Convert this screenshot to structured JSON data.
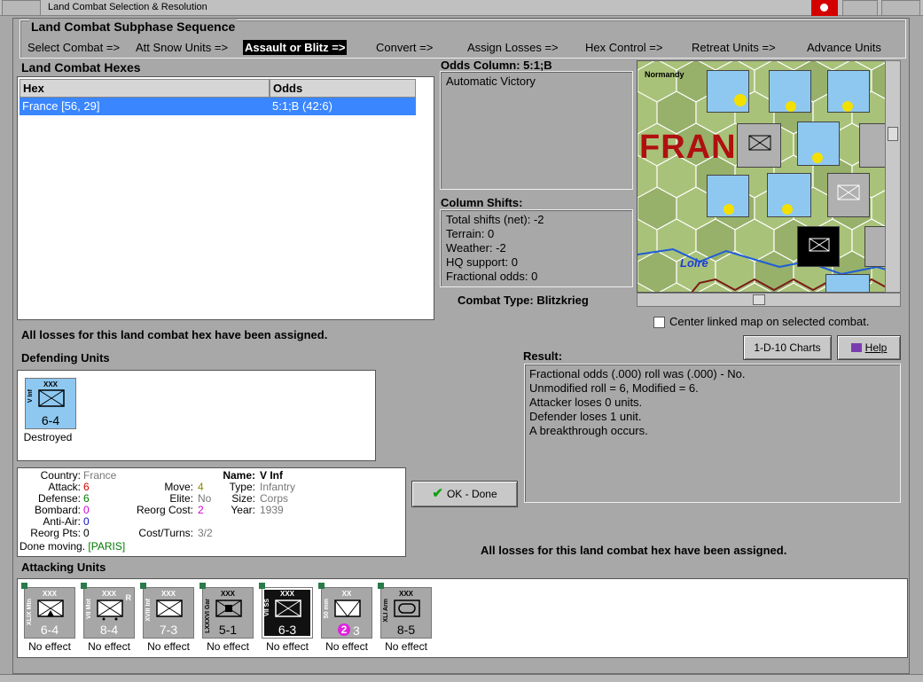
{
  "window_title": "Land Combat Selection & Resolution",
  "sequence": {
    "title": "Land Combat Subphase Sequence",
    "steps": [
      "Select Combat =>",
      "Att Snow Units =>",
      "Assault or Blitz =>",
      "Convert =>",
      "Assign Losses =>",
      "Hex Control =>",
      "Retreat Units =>",
      "Advance Units"
    ],
    "active_step": "Assault or Blitz =>"
  },
  "hexes_panel": {
    "title": "Land Combat Hexes",
    "columns": [
      "Hex",
      "Odds"
    ],
    "rows": [
      {
        "hex": "France [56, 29]",
        "odds": "5:1;B (42:6)"
      }
    ]
  },
  "odds_column": {
    "title": "Odds Column: 5:1;B",
    "result_text": "Automatic Victory"
  },
  "column_shifts": {
    "title": "Column Shifts:",
    "lines": [
      "Total shifts (net): -2",
      "Terrain: 0",
      "Weather: -2",
      "HQ support: 0",
      "Fractional odds: 0"
    ]
  },
  "combat_type": "Combat Type:  Blitzkrieg",
  "map": {
    "labels": {
      "normandy": "Normandy",
      "france": "FRANC",
      "loire": "Loire"
    },
    "center_label": "Center linked map on selected combat."
  },
  "status_message": "All losses for this land combat hex have been assigned.",
  "buttons": {
    "charts": "1-D-10 Charts",
    "help": "Help",
    "ok": "OK - Done"
  },
  "result": {
    "title": "Result:",
    "lines": [
      "Fractional odds (.000) roll was (.000)  - No.",
      "Unmodified roll = 6, Modified = 6.",
      "Attacker loses 0 units.",
      "Defender loses 1 unit.",
      "A breakthrough occurs."
    ]
  },
  "defending": {
    "title": "Defending Units",
    "units": [
      {
        "top": "XXX",
        "side": "V Inf",
        "value": "6-4",
        "status": "Destroyed"
      }
    ]
  },
  "details": {
    "country_label": "Country:",
    "country": "France",
    "attack_label": "Attack:",
    "attack": "6",
    "defense_label": "Defense:",
    "defense": "6",
    "bombard_label": "Bombard:",
    "bombard": "0",
    "antiair_label": "Anti-Air:",
    "antiair": "0",
    "reorgpts_label": "Reorg Pts:",
    "reorgpts": "0",
    "move_label": "Move:",
    "move": "4",
    "elite_label": "Elite:",
    "elite": "No",
    "reorgcost_label": "Reorg Cost:",
    "reorgcost": "2",
    "costturns_label": "Cost/Turns:",
    "costturns": "3/2",
    "name_label": "Name:",
    "name": "V Inf",
    "type_label": "Type:",
    "type": "Infantry",
    "size_label": "Size:",
    "size": "Corps",
    "year_label": "Year:",
    "year": "1939",
    "done_moving": "Done moving.",
    "location": "[PARIS]"
  },
  "attacking": {
    "title": "Attacking Units",
    "units": [
      {
        "top": "XXX",
        "side": "XLIX Mtn",
        "value": "6-4",
        "status": "No effect"
      },
      {
        "top": "XXX",
        "side": "VII Mot",
        "value": "8-4",
        "status": "No effect",
        "badge": "R"
      },
      {
        "top": "XXX",
        "side": "XVIII Inf",
        "value": "7-3",
        "status": "No effect"
      },
      {
        "top": "XXX",
        "side": "LXXXVI Gar",
        "value": "5-1",
        "status": "No effect"
      },
      {
        "top": "XXX",
        "side": "VII SS",
        "value": "6-3",
        "status": "No effect"
      },
      {
        "top": "XX",
        "side": "50 mm",
        "value": "3",
        "extra": "2",
        "status": "No effect"
      },
      {
        "top": "XXX",
        "side": "XLI Arm",
        "value": "8-5",
        "status": "No effect"
      }
    ]
  },
  "colors": {
    "selection": "#3a86ff",
    "panel": "#a8a8a8",
    "counter_blue": "#8ec8f0",
    "counter_gray": "#a7a7a7",
    "counter_black": "#111111"
  }
}
